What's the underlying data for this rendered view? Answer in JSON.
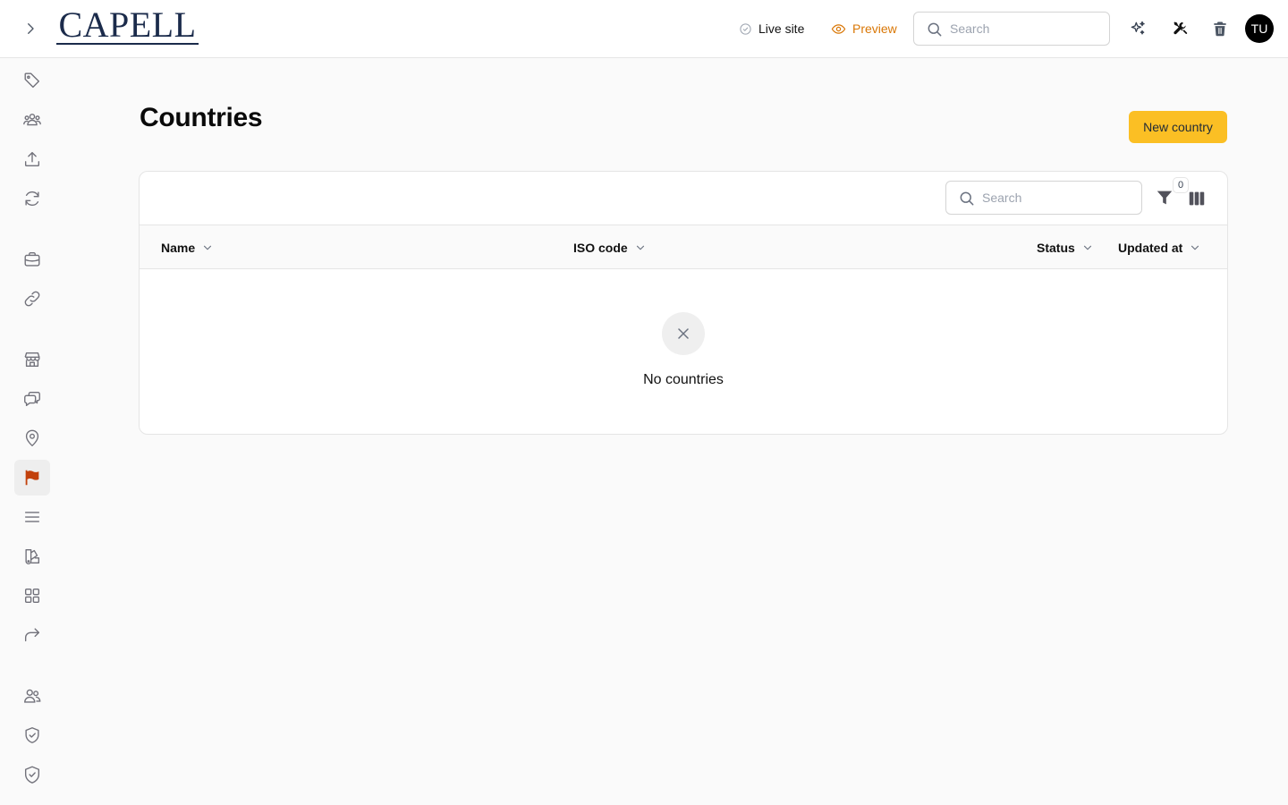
{
  "header": {
    "logo_text": "CAPELL",
    "live_site_label": "Live site",
    "preview_label": "Preview",
    "search_placeholder": "Search",
    "avatar_initials": "TU"
  },
  "sidebar": {
    "active_item": "countries",
    "items": [
      {
        "id": "tags",
        "icon": "tag-icon"
      },
      {
        "id": "users-group",
        "icon": "user-group-icon"
      },
      {
        "id": "uploads",
        "icon": "upload-icon"
      },
      {
        "id": "sync",
        "icon": "refresh-icon"
      },
      {
        "id": "portfolio",
        "icon": "briefcase-icon"
      },
      {
        "id": "links",
        "icon": "link-icon"
      },
      {
        "id": "stores",
        "icon": "storefront-icon"
      },
      {
        "id": "chats",
        "icon": "chat-bubbles-icon"
      },
      {
        "id": "locations",
        "icon": "map-pin-icon"
      },
      {
        "id": "countries",
        "icon": "flag-icon"
      },
      {
        "id": "menu",
        "icon": "bars-icon"
      },
      {
        "id": "themes",
        "icon": "swatch-icon"
      },
      {
        "id": "apps",
        "icon": "grid-icon"
      },
      {
        "id": "redirects",
        "icon": "redirect-arrow-icon"
      },
      {
        "id": "people",
        "icon": "users-icon"
      },
      {
        "id": "security",
        "icon": "shield-check-icon"
      },
      {
        "id": "permissions",
        "icon": "shield-check-filled-icon"
      }
    ]
  },
  "page": {
    "title": "Countries",
    "new_button_label": "New country"
  },
  "table": {
    "search_placeholder": "Search",
    "active_filters_count": "0",
    "columns": [
      {
        "label": "Name"
      },
      {
        "label": "ISO code"
      },
      {
        "label": "Status"
      },
      {
        "label": "Updated at"
      }
    ],
    "rows": [],
    "empty_message": "No countries"
  },
  "colors": {
    "accent": "#fbbf24",
    "preview": "#d97706",
    "active_icon": "#c2410c",
    "logo": "#1b2b4b"
  }
}
